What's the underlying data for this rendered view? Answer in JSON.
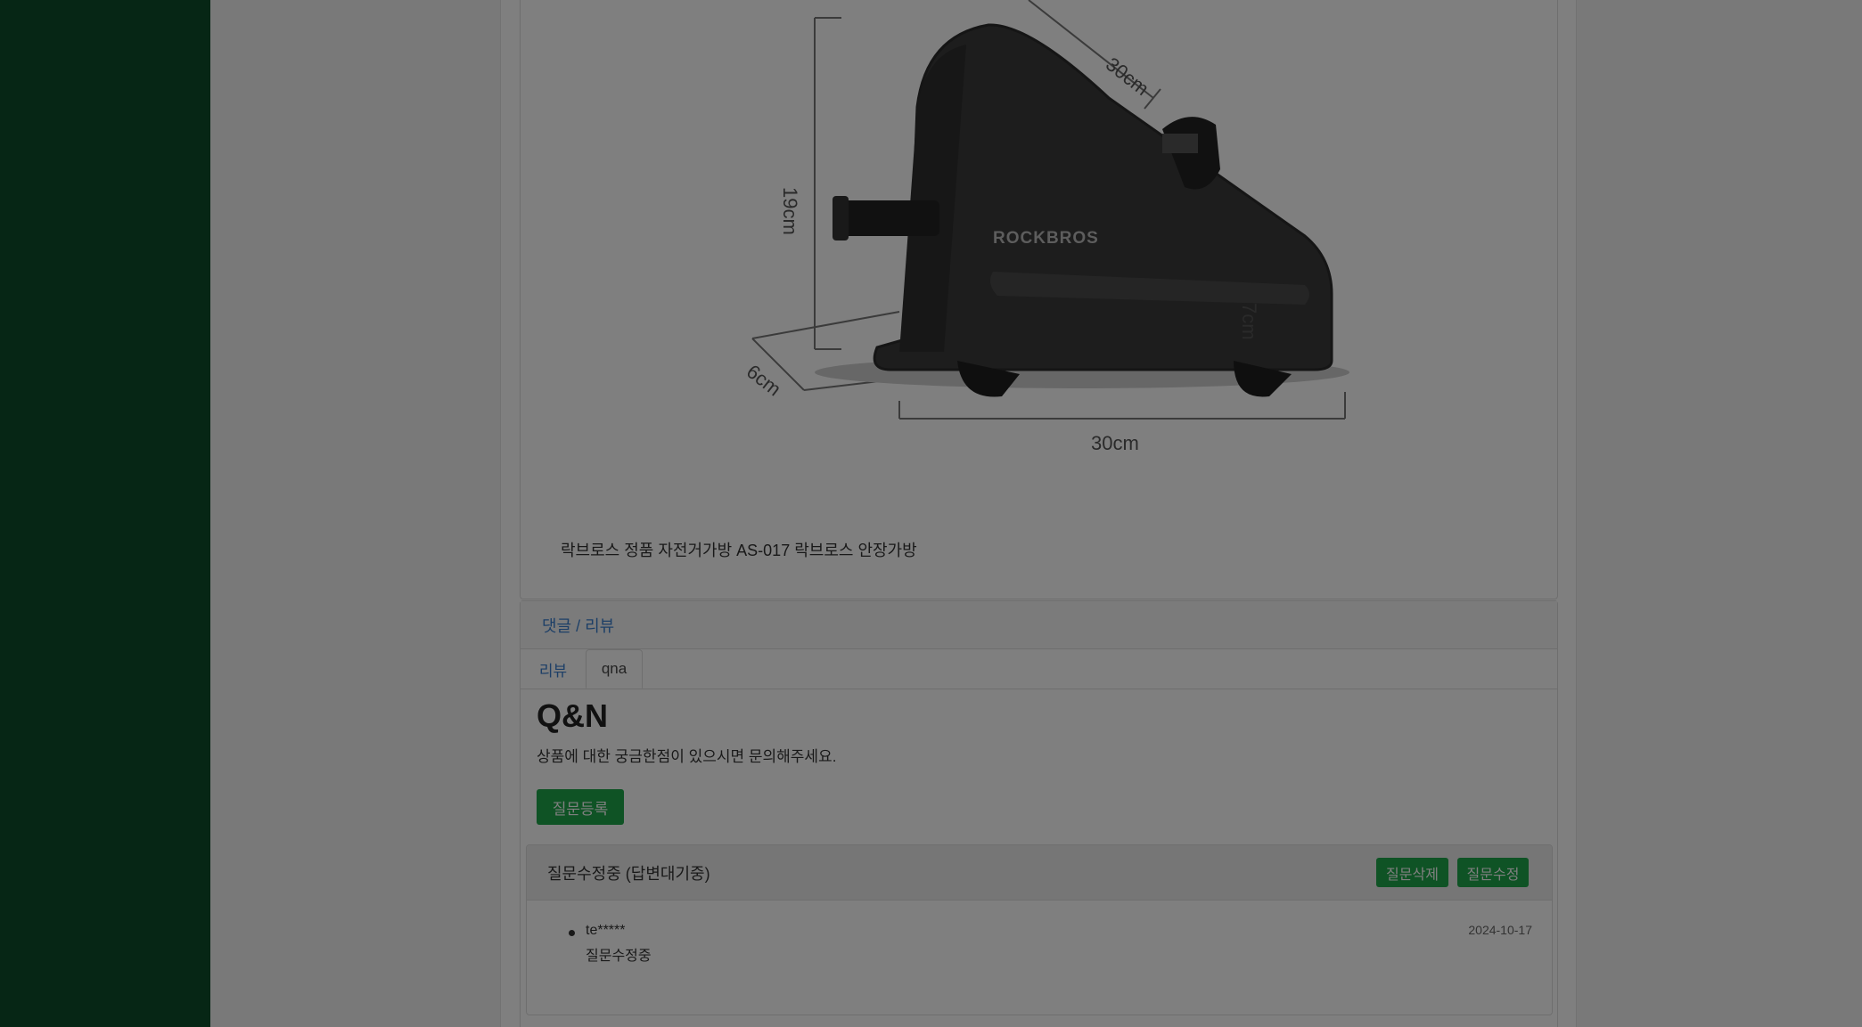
{
  "product": {
    "caption": "락브로스 정품 자전거가방 AS-017 락브로스 안장가방",
    "image": {
      "brand": "ROCKBROS",
      "dims": {
        "diagonal": "30cm",
        "height_left": "19cm",
        "height_right": "7cm",
        "depth": "6cm",
        "width": "30cm"
      }
    }
  },
  "reviews": {
    "header": "댓글 / 리뷰",
    "tabs": {
      "review": "리뷰",
      "qna": "qna"
    },
    "qna": {
      "title": "Q&N",
      "subtitle": "상품에 대한 궁금한점이 있으시면 문의해주세요.",
      "register_button": "질문등록",
      "question": {
        "status": "질문수정중 (답변대기중)",
        "delete_button": "질문삭제",
        "edit_button": "질문수정",
        "author": "te*****",
        "text": "질문수정중",
        "date": "2024-10-17"
      }
    }
  },
  "colors": {
    "sidebar": "#0d4d2a",
    "accent_green": "#1fa64a",
    "link_blue": "#3b7fcf",
    "overlay": "rgba(0,0,0,0.5)"
  }
}
